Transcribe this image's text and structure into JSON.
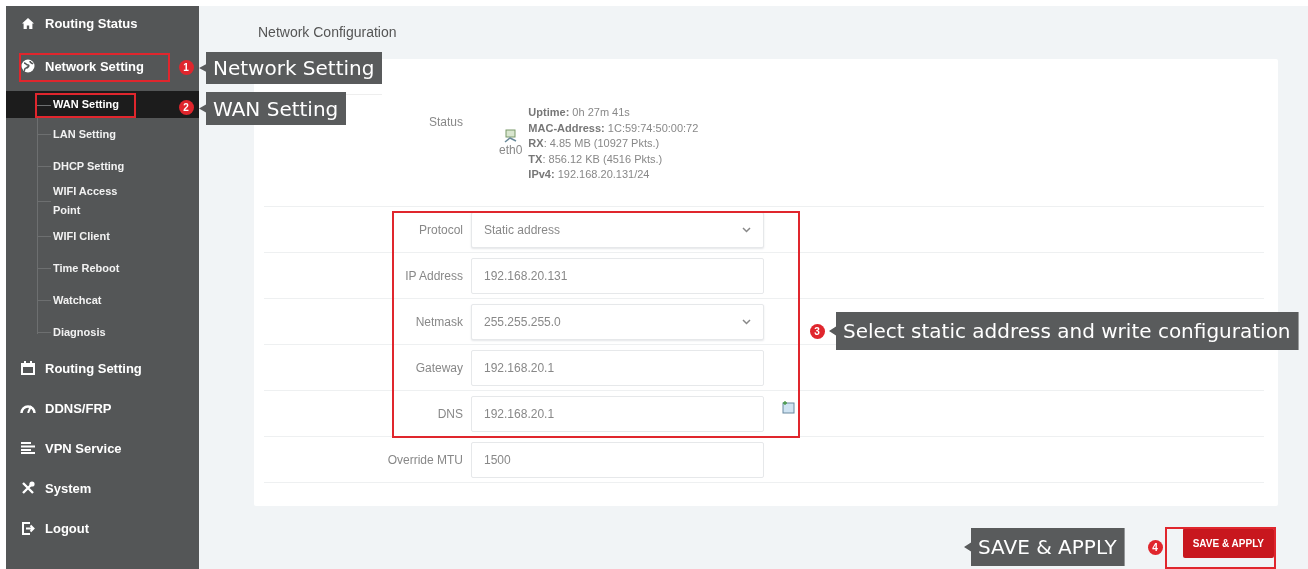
{
  "sidebar": {
    "items": [
      {
        "label": "Routing Status"
      },
      {
        "label": "Network Setting",
        "children": [
          {
            "label": "WAN Setting",
            "selected": true
          },
          {
            "label": "LAN Setting",
            "selected": false
          },
          {
            "label": "DHCP Setting",
            "selected": false
          },
          {
            "label": "WIFI Access Point",
            "selected": false
          },
          {
            "label": "WIFI Client",
            "selected": false
          },
          {
            "label": "Time Reboot",
            "selected": false
          },
          {
            "label": "Watchcat",
            "selected": false
          },
          {
            "label": "Diagnosis",
            "selected": false
          }
        ]
      },
      {
        "label": "Routing Setting"
      },
      {
        "label": "DDNS/FRP"
      },
      {
        "label": "VPN Service"
      },
      {
        "label": "System"
      },
      {
        "label": "Logout"
      }
    ]
  },
  "page_title": "Network Configuration",
  "status": {
    "label": "Status",
    "interface": "eth0",
    "lines": [
      "**Uptime:** 0h 27m 41s",
      "**MAC-Address:** 1C:59:74:50:00:72",
      "**RX**: 4.85 MB (10927 Pkts.)",
      "**TX**: 856.12 KB (4516 Pkts.)",
      "**IPv4:** 192.168.20.131/24"
    ]
  },
  "fields": [
    {
      "label": "Protocol",
      "kind": "select",
      "value": "Static address"
    },
    {
      "label": "IP Address",
      "kind": "text",
      "value": "192.168.20.131"
    },
    {
      "label": "Netmask",
      "kind": "select",
      "value": "255.255.255.0"
    },
    {
      "label": "Gateway",
      "kind": "text",
      "value": "192.168.20.1"
    },
    {
      "label": "DNS",
      "kind": "list",
      "value": "192.168.20.1"
    },
    {
      "label": "Override MTU",
      "kind": "text",
      "value": "1500"
    }
  ],
  "save_button": "SAVE & APPLY",
  "annotations": [
    {
      "number": "1",
      "text": "Network Setting"
    },
    {
      "number": "2",
      "text": "WAN Setting"
    },
    {
      "number": "3",
      "text": "Select static address and write configuration"
    },
    {
      "number": "4",
      "text": "SAVE & APPLY"
    }
  ]
}
